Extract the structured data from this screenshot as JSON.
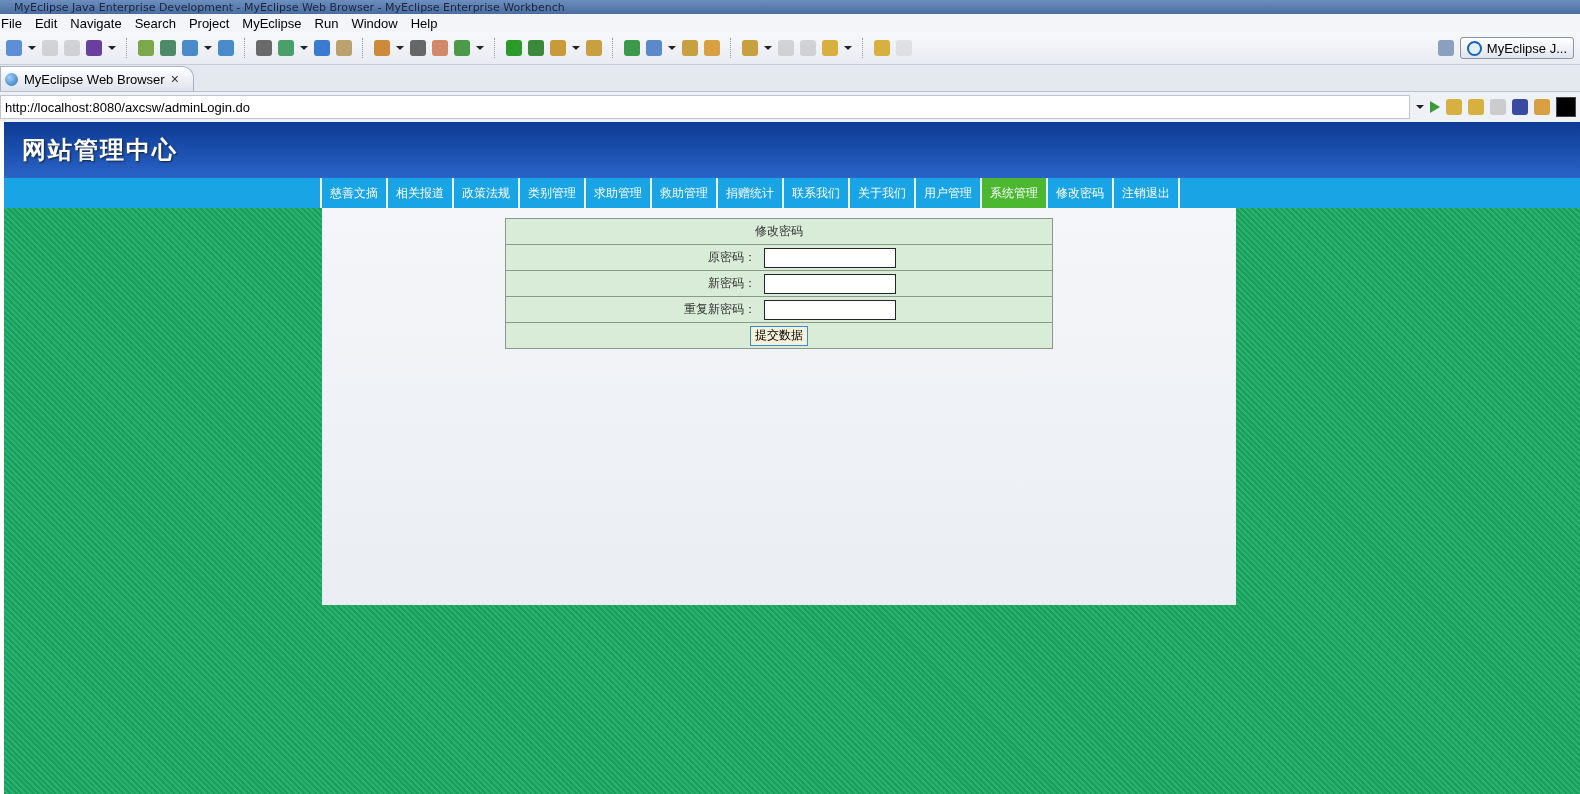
{
  "window": {
    "title": "MyEclipse Java Enterprise Development - MyEclipse Web Browser - MyEclipse Enterprise Workbench"
  },
  "menu": [
    "File",
    "Edit",
    "Navigate",
    "Search",
    "Project",
    "MyEclipse",
    "Run",
    "Window",
    "Help"
  ],
  "perspective": {
    "label": "MyEclipse J..."
  },
  "editor_tab": {
    "label": "MyEclipse Web Browser",
    "close": "×"
  },
  "address_bar": {
    "value": "http://localhost:8080/axcsw/adminLogin.do"
  },
  "site": {
    "title": "网站管理中心",
    "nav": [
      {
        "label": "慈善文摘",
        "selected": false
      },
      {
        "label": "相关报道",
        "selected": false
      },
      {
        "label": "政策法规",
        "selected": false
      },
      {
        "label": "类别管理",
        "selected": false
      },
      {
        "label": "求助管理",
        "selected": false
      },
      {
        "label": "救助管理",
        "selected": false
      },
      {
        "label": "捐赠统计",
        "selected": false
      },
      {
        "label": "联系我们",
        "selected": false
      },
      {
        "label": "关于我们",
        "selected": false
      },
      {
        "label": "用户管理",
        "selected": false
      },
      {
        "label": "系统管理",
        "selected": true
      },
      {
        "label": "修改密码",
        "selected": false
      },
      {
        "label": "注销退出",
        "selected": false
      }
    ],
    "form": {
      "title": "修改密码",
      "fields": [
        {
          "label": "原密码："
        },
        {
          "label": "新密码："
        },
        {
          "label": "重复新密码："
        }
      ],
      "submit": "提交数据"
    }
  }
}
